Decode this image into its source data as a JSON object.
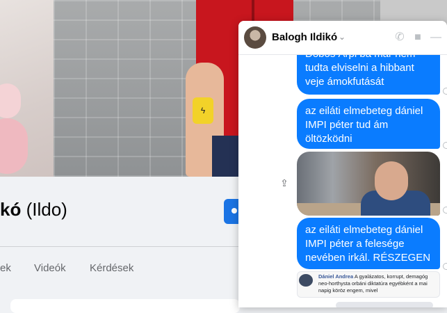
{
  "profile": {
    "name_fragment": "kó",
    "alt_name": "(Ildo)",
    "tabs": [
      "ek",
      "Videók",
      "Kérdések"
    ]
  },
  "chat": {
    "contact_name": "Balogh Ildikó",
    "header_icons": [
      "phone-icon",
      "video-icon",
      "minimize-icon"
    ],
    "messages": [
      "Dobos Árpi bá már nem tudta elviselni a hibbant veje ámokfutását",
      "az eiláti elmebeteg dániel IMPI péter tud ám öltözködni",
      "az eiláti elmebeteg dániel IMPI péter a felesége nevében irkál. RÉSZEGEN ."
    ],
    "quote": {
      "author": "Dániel Andrea",
      "text": "A gyalázatos, korrupt, demagóg neo-horthysta orbáni diktatúra egyébként a mai napig köröz engem, mivel"
    }
  },
  "colors": {
    "messenger_blue": "#0a7cff",
    "fb_blue": "#1b74e4"
  }
}
